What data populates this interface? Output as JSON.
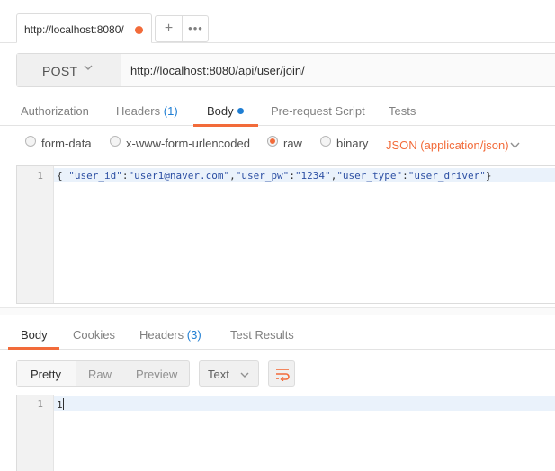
{
  "colors": {
    "accent": "#f26b3a",
    "blue": "#1f7ed3"
  },
  "tab": {
    "title": "http://localhost:8080/",
    "unsaved_icon": "orange-dot-icon"
  },
  "tab_buttons": {
    "add_icon": "plus-icon",
    "more_icon": "more-icon"
  },
  "request": {
    "method": "POST",
    "url": "http://localhost:8080/api/user/join/"
  },
  "request_tabs": [
    {
      "label": "Authorization"
    },
    {
      "label": "Headers",
      "count": "(1)"
    },
    {
      "label": "Body",
      "active": true
    },
    {
      "label": "Pre-request Script"
    },
    {
      "label": "Tests"
    }
  ],
  "body_modes": {
    "form_data": "form-data",
    "urlencoded": "x-www-form-urlencoded",
    "raw": "raw",
    "binary": "binary",
    "selected": "raw",
    "content_type": "JSON (application/json)"
  },
  "request_body": {
    "line_numbers": [
      "1"
    ],
    "code": {
      "open": "{ ",
      "k1": "\"user_id\"",
      "v1": "\"user1@naver.com\"",
      "k2": "\"user_pw\"",
      "v2": "\"1234\"",
      "k3": "\"user_type\"",
      "v3": "\"user_driver\"",
      "colon": ":",
      "comma": ",",
      "close": "}"
    }
  },
  "response_tabs": [
    {
      "label": "Body",
      "active": true
    },
    {
      "label": "Cookies"
    },
    {
      "label": "Headers",
      "count": "(3)"
    },
    {
      "label": "Test Results"
    }
  ],
  "response_toolbar": {
    "views": [
      "Pretty",
      "Raw",
      "Preview"
    ],
    "selected_view": "Pretty",
    "format": "Text",
    "wrap_icon": "wrap-lines-icon"
  },
  "response_body": {
    "line_numbers": [
      "1"
    ],
    "content": "1"
  }
}
